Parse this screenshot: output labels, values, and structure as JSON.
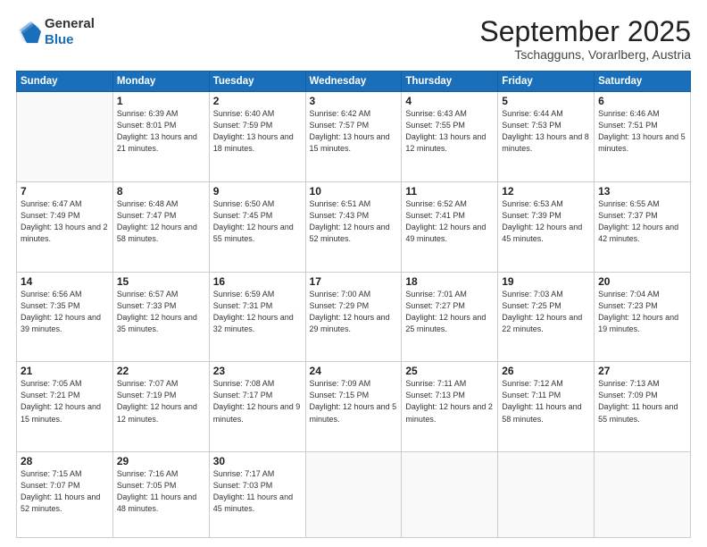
{
  "logo": {
    "line1": "General",
    "line2": "Blue"
  },
  "title": "September 2025",
  "location": "Tschagguns, Vorarlberg, Austria",
  "days_header": [
    "Sunday",
    "Monday",
    "Tuesday",
    "Wednesday",
    "Thursday",
    "Friday",
    "Saturday"
  ],
  "weeks": [
    [
      {
        "day": "",
        "sunrise": "",
        "sunset": "",
        "daylight": ""
      },
      {
        "day": "1",
        "sunrise": "Sunrise: 6:39 AM",
        "sunset": "Sunset: 8:01 PM",
        "daylight": "Daylight: 13 hours and 21 minutes."
      },
      {
        "day": "2",
        "sunrise": "Sunrise: 6:40 AM",
        "sunset": "Sunset: 7:59 PM",
        "daylight": "Daylight: 13 hours and 18 minutes."
      },
      {
        "day": "3",
        "sunrise": "Sunrise: 6:42 AM",
        "sunset": "Sunset: 7:57 PM",
        "daylight": "Daylight: 13 hours and 15 minutes."
      },
      {
        "day": "4",
        "sunrise": "Sunrise: 6:43 AM",
        "sunset": "Sunset: 7:55 PM",
        "daylight": "Daylight: 13 hours and 12 minutes."
      },
      {
        "day": "5",
        "sunrise": "Sunrise: 6:44 AM",
        "sunset": "Sunset: 7:53 PM",
        "daylight": "Daylight: 13 hours and 8 minutes."
      },
      {
        "day": "6",
        "sunrise": "Sunrise: 6:46 AM",
        "sunset": "Sunset: 7:51 PM",
        "daylight": "Daylight: 13 hours and 5 minutes."
      }
    ],
    [
      {
        "day": "7",
        "sunrise": "Sunrise: 6:47 AM",
        "sunset": "Sunset: 7:49 PM",
        "daylight": "Daylight: 13 hours and 2 minutes."
      },
      {
        "day": "8",
        "sunrise": "Sunrise: 6:48 AM",
        "sunset": "Sunset: 7:47 PM",
        "daylight": "Daylight: 12 hours and 58 minutes."
      },
      {
        "day": "9",
        "sunrise": "Sunrise: 6:50 AM",
        "sunset": "Sunset: 7:45 PM",
        "daylight": "Daylight: 12 hours and 55 minutes."
      },
      {
        "day": "10",
        "sunrise": "Sunrise: 6:51 AM",
        "sunset": "Sunset: 7:43 PM",
        "daylight": "Daylight: 12 hours and 52 minutes."
      },
      {
        "day": "11",
        "sunrise": "Sunrise: 6:52 AM",
        "sunset": "Sunset: 7:41 PM",
        "daylight": "Daylight: 12 hours and 49 minutes."
      },
      {
        "day": "12",
        "sunrise": "Sunrise: 6:53 AM",
        "sunset": "Sunset: 7:39 PM",
        "daylight": "Daylight: 12 hours and 45 minutes."
      },
      {
        "day": "13",
        "sunrise": "Sunrise: 6:55 AM",
        "sunset": "Sunset: 7:37 PM",
        "daylight": "Daylight: 12 hours and 42 minutes."
      }
    ],
    [
      {
        "day": "14",
        "sunrise": "Sunrise: 6:56 AM",
        "sunset": "Sunset: 7:35 PM",
        "daylight": "Daylight: 12 hours and 39 minutes."
      },
      {
        "day": "15",
        "sunrise": "Sunrise: 6:57 AM",
        "sunset": "Sunset: 7:33 PM",
        "daylight": "Daylight: 12 hours and 35 minutes."
      },
      {
        "day": "16",
        "sunrise": "Sunrise: 6:59 AM",
        "sunset": "Sunset: 7:31 PM",
        "daylight": "Daylight: 12 hours and 32 minutes."
      },
      {
        "day": "17",
        "sunrise": "Sunrise: 7:00 AM",
        "sunset": "Sunset: 7:29 PM",
        "daylight": "Daylight: 12 hours and 29 minutes."
      },
      {
        "day": "18",
        "sunrise": "Sunrise: 7:01 AM",
        "sunset": "Sunset: 7:27 PM",
        "daylight": "Daylight: 12 hours and 25 minutes."
      },
      {
        "day": "19",
        "sunrise": "Sunrise: 7:03 AM",
        "sunset": "Sunset: 7:25 PM",
        "daylight": "Daylight: 12 hours and 22 minutes."
      },
      {
        "day": "20",
        "sunrise": "Sunrise: 7:04 AM",
        "sunset": "Sunset: 7:23 PM",
        "daylight": "Daylight: 12 hours and 19 minutes."
      }
    ],
    [
      {
        "day": "21",
        "sunrise": "Sunrise: 7:05 AM",
        "sunset": "Sunset: 7:21 PM",
        "daylight": "Daylight: 12 hours and 15 minutes."
      },
      {
        "day": "22",
        "sunrise": "Sunrise: 7:07 AM",
        "sunset": "Sunset: 7:19 PM",
        "daylight": "Daylight: 12 hours and 12 minutes."
      },
      {
        "day": "23",
        "sunrise": "Sunrise: 7:08 AM",
        "sunset": "Sunset: 7:17 PM",
        "daylight": "Daylight: 12 hours and 9 minutes."
      },
      {
        "day": "24",
        "sunrise": "Sunrise: 7:09 AM",
        "sunset": "Sunset: 7:15 PM",
        "daylight": "Daylight: 12 hours and 5 minutes."
      },
      {
        "day": "25",
        "sunrise": "Sunrise: 7:11 AM",
        "sunset": "Sunset: 7:13 PM",
        "daylight": "Daylight: 12 hours and 2 minutes."
      },
      {
        "day": "26",
        "sunrise": "Sunrise: 7:12 AM",
        "sunset": "Sunset: 7:11 PM",
        "daylight": "Daylight: 11 hours and 58 minutes."
      },
      {
        "day": "27",
        "sunrise": "Sunrise: 7:13 AM",
        "sunset": "Sunset: 7:09 PM",
        "daylight": "Daylight: 11 hours and 55 minutes."
      }
    ],
    [
      {
        "day": "28",
        "sunrise": "Sunrise: 7:15 AM",
        "sunset": "Sunset: 7:07 PM",
        "daylight": "Daylight: 11 hours and 52 minutes."
      },
      {
        "day": "29",
        "sunrise": "Sunrise: 7:16 AM",
        "sunset": "Sunset: 7:05 PM",
        "daylight": "Daylight: 11 hours and 48 minutes."
      },
      {
        "day": "30",
        "sunrise": "Sunrise: 7:17 AM",
        "sunset": "Sunset: 7:03 PM",
        "daylight": "Daylight: 11 hours and 45 minutes."
      },
      {
        "day": "",
        "sunrise": "",
        "sunset": "",
        "daylight": ""
      },
      {
        "day": "",
        "sunrise": "",
        "sunset": "",
        "daylight": ""
      },
      {
        "day": "",
        "sunrise": "",
        "sunset": "",
        "daylight": ""
      },
      {
        "day": "",
        "sunrise": "",
        "sunset": "",
        "daylight": ""
      }
    ]
  ]
}
